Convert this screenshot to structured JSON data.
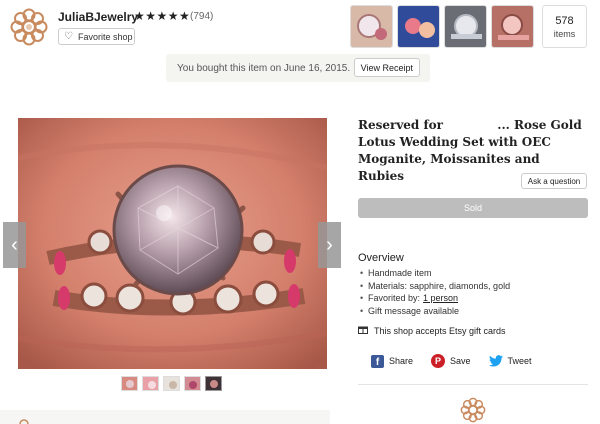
{
  "shop": {
    "name": "JuliaBJewelry",
    "stars": "★★★★★",
    "review_count": "(794)",
    "favorite_label": "Favorite shop",
    "items_count": "578",
    "items_label": "items",
    "logo_icon": "lotus-flower-logo",
    "accent_color": "#c98a5e"
  },
  "purchase": {
    "message": "You bought this item on June 16, 2015.",
    "receipt_button": "View Receipt"
  },
  "listing": {
    "title": "Reserved for             ... Rose Gold Lotus Wedding Set with OEC Moganite, Moissanites and Rubies",
    "ask_question": "Ask a question",
    "sold_label": "Sold",
    "overview_title": "Overview",
    "overview": {
      "handmade": "Handmade item",
      "materials": "Materials: sapphire, diamonds, gold",
      "favorited_prefix": "Favorited by:",
      "favorited_link": "1 person",
      "gift": "Gift message available"
    },
    "gift_cards": "This shop accepts Etsy gift cards"
  },
  "share": {
    "facebook": "Share",
    "pinterest": "Save",
    "twitter": "Tweet"
  },
  "gallery": {
    "prev_icon": "chevron-left-icon",
    "next_icon": "chevron-right-icon",
    "prev_glyph": "‹",
    "next_glyph": "›"
  }
}
